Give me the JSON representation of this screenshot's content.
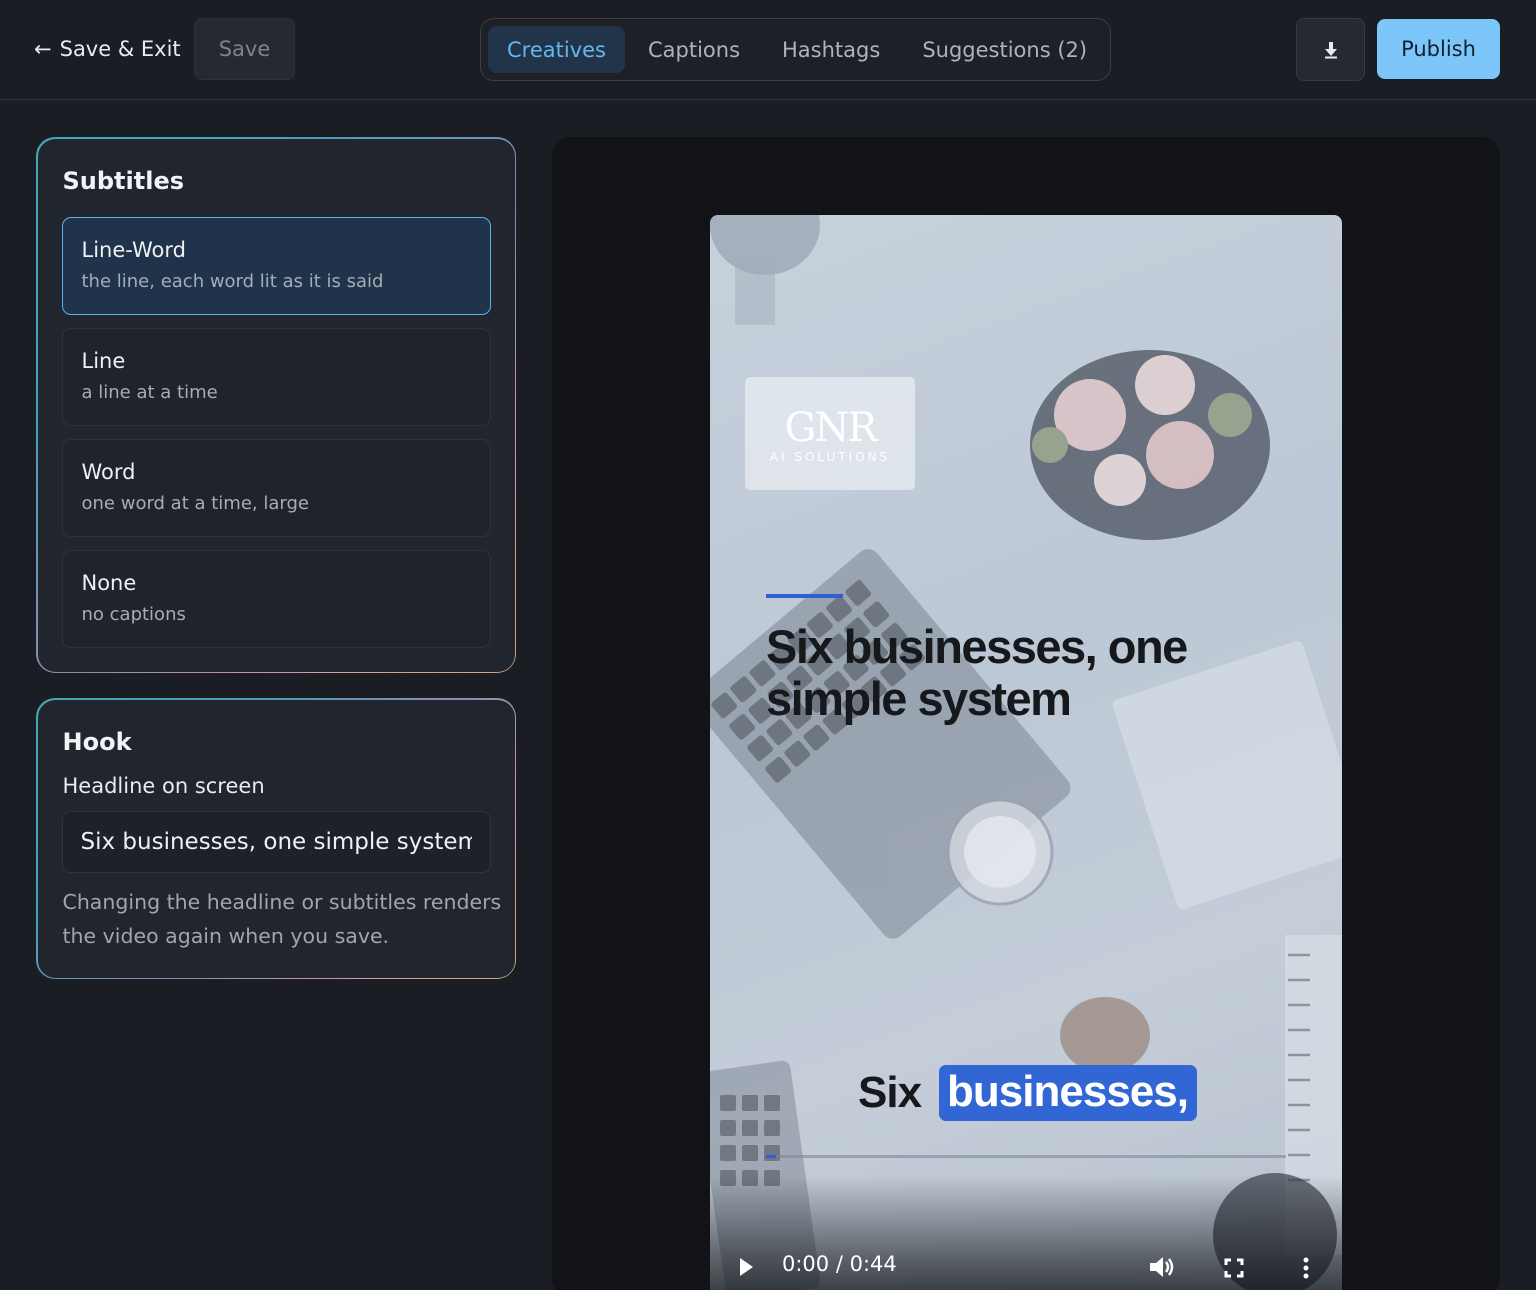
{
  "header": {
    "back_label": "Save & Exit",
    "back_arrow": "←",
    "save_label": "Save",
    "tabs": [
      {
        "label": "Creatives",
        "active": true
      },
      {
        "label": "Captions",
        "active": false
      },
      {
        "label": "Hashtags",
        "active": false
      },
      {
        "label": "Suggestions (2)",
        "active": false
      }
    ],
    "download_icon": "download-icon",
    "publish_label": "Publish"
  },
  "subtitles": {
    "title": "Subtitles",
    "options": [
      {
        "name": "Line-Word",
        "desc": "the line, each word lit as it is said",
        "selected": true
      },
      {
        "name": "Line",
        "desc": "a line at a time",
        "selected": false
      },
      {
        "name": "Word",
        "desc": "one word at a time, large",
        "selected": false
      },
      {
        "name": "None",
        "desc": "no captions",
        "selected": false
      }
    ]
  },
  "hook": {
    "title": "Hook",
    "label": "Headline on screen",
    "value": "Six businesses, one simple system",
    "note": "Changing the headline or subtitles renders the video again when you save."
  },
  "preview": {
    "logo_text": "GNR",
    "logo_sub": "AI SOLUTIONS",
    "headline": "Six businesses, one simple system",
    "subtitle_words": [
      "Six",
      "businesses,"
    ],
    "highlighted_word_index": 1,
    "progress": 0.02,
    "time": "0:00 / 0:44",
    "colors": {
      "accent": "#2f5fd6",
      "highlight": "#3166d4",
      "publish": "#7cc6f9"
    }
  }
}
